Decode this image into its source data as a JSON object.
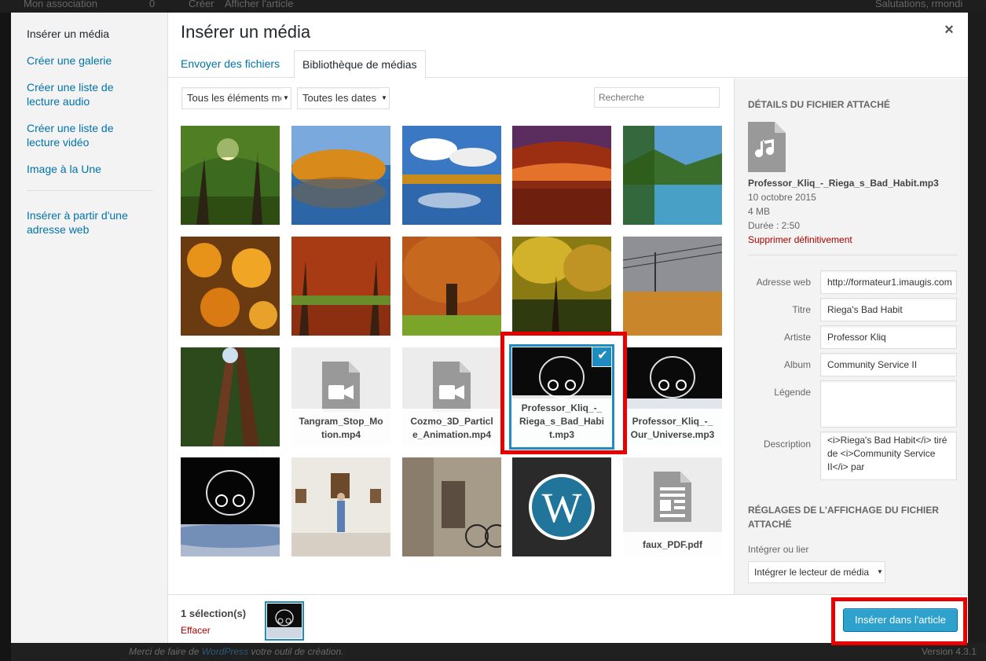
{
  "adminbar": {
    "site": "Mon association",
    "comments": "0",
    "new": "Créer",
    "view": "Afficher l'article",
    "greeting": "Salutations, rmondi"
  },
  "footer": {
    "thanks_prefix": "Merci de faire de ",
    "thanks_link": "WordPress",
    "thanks_suffix": " votre outil de création.",
    "version": "Version 4.3.1"
  },
  "menu": {
    "items": [
      {
        "label": "Insérer un média",
        "active": true
      },
      {
        "label": "Créer une galerie"
      },
      {
        "label": "Créer une liste de lecture audio"
      },
      {
        "label": "Créer une liste de lecture vidéo"
      },
      {
        "label": "Image à la Une"
      },
      {
        "label": "Insérer à partir d'une adresse web"
      }
    ]
  },
  "modal": {
    "title": "Insérer un média",
    "close": "×",
    "tabs": [
      {
        "label": "Envoyer des fichiers"
      },
      {
        "label": "Bibliothèque de médias",
        "active": true
      }
    ]
  },
  "filters": {
    "type": "Tous les éléments média",
    "date": "Toutes les dates",
    "search_placeholder": "Recherche"
  },
  "attachments": [
    {
      "kind": "image",
      "icon": "photo-forest-sun"
    },
    {
      "kind": "image",
      "icon": "photo-autumn-lake"
    },
    {
      "kind": "image",
      "icon": "photo-lake-sky"
    },
    {
      "kind": "image",
      "icon": "photo-arch-sunset"
    },
    {
      "kind": "image",
      "icon": "photo-mountain-lake"
    },
    {
      "kind": "image",
      "icon": "photo-orange-leaves"
    },
    {
      "kind": "image",
      "icon": "photo-autumn-park"
    },
    {
      "kind": "image",
      "icon": "photo-autumn-tree"
    },
    {
      "kind": "image",
      "icon": "photo-yellow-forest"
    },
    {
      "kind": "image",
      "icon": "photo-wheat-field"
    },
    {
      "kind": "image",
      "icon": "photo-redwoods"
    },
    {
      "kind": "video",
      "filename": "Tangram_Stop_Motion.mp4",
      "icon": "video-file-icon"
    },
    {
      "kind": "video",
      "filename": "Cozmo_3D_Particle_Animation.mp4",
      "icon": "video-file-icon"
    },
    {
      "kind": "audio",
      "filename": "Professor_Kliq_-_Riega_s_Bad_Habit.mp3",
      "selected": true,
      "icon": "headphones-art"
    },
    {
      "kind": "audio",
      "filename": "Professor_Kliq_-_Our_Universe.mp3",
      "icon": "headphones-art"
    },
    {
      "kind": "image",
      "icon": "photo-headphones-earth"
    },
    {
      "kind": "image",
      "icon": "photo-gallery-woman"
    },
    {
      "kind": "image",
      "icon": "photo-street-bicycle"
    },
    {
      "kind": "image",
      "icon": "wordpress-logo"
    },
    {
      "kind": "document",
      "filename": "faux_PDF.pdf",
      "icon": "document-file-icon"
    }
  ],
  "details": {
    "heading": "Détails du fichier attaché",
    "filename": "Professor_Kliq_-_Riega_s_Bad_Habit.mp3",
    "date": "10 octobre 2015",
    "size": "4 MB",
    "duration": "Durée : 2:50",
    "delete": "Supprimer définitivement",
    "fields": {
      "url": {
        "label": "Adresse web",
        "value": "http://formateur1.imaugis.com"
      },
      "title": {
        "label": "Titre",
        "value": "Riega's Bad Habit"
      },
      "artist": {
        "label": "Artiste",
        "value": "Professor Kliq"
      },
      "album": {
        "label": "Album",
        "value": "Community Service II"
      },
      "caption": {
        "label": "Légende",
        "value": ""
      },
      "description": {
        "label": "Description",
        "value": "<i>Riega's Bad Habit</i> tiré de <i>Community Service II</i> par"
      }
    },
    "display_heading": "Réglages de l'affichage du fichier attaché",
    "embed_label": "Intégrer ou lier",
    "embed_value": "Intégrer le lecteur de média"
  },
  "toolbar": {
    "count": "1 sélection(s)",
    "clear": "Effacer",
    "insert": "Insérer dans l'article"
  },
  "colors": {
    "accent": "#1e8cbe",
    "link": "#0073aa",
    "delete": "#a00",
    "primary_button": "#2ea2cc",
    "highlight": "#e60000"
  }
}
